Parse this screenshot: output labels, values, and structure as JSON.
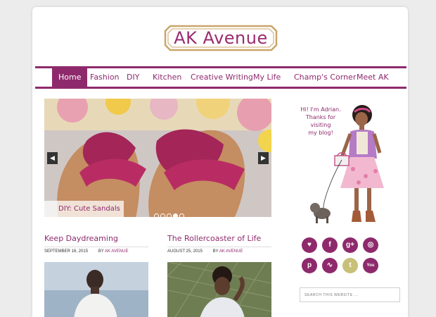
{
  "logo": {
    "text": "AK Avenue"
  },
  "nav": {
    "items": [
      {
        "label": "Home",
        "active": true
      },
      {
        "label": "Fashion"
      },
      {
        "label": "DIY"
      },
      {
        "label": "Kitchen"
      },
      {
        "label": "Creative Writing"
      },
      {
        "label": "My Life"
      },
      {
        "label": "Champ's Corner"
      },
      {
        "label": "Meet AK"
      }
    ]
  },
  "slider": {
    "caption": "DIY: Cute Sandals",
    "prev_icon": "chevron-left-icon",
    "next_icon": "chevron-right-icon",
    "dot_count": 5,
    "active_dot": 4
  },
  "posts": [
    {
      "title": "Keep Daydreaming",
      "date": "SEPTEMBER 16, 2015",
      "by": "BY",
      "author": "AK AVENUE"
    },
    {
      "title": "The Rollercoaster of Life",
      "date": "AUGUST 25, 2015",
      "by": "BY",
      "author": "AK AVENUE"
    }
  ],
  "sidebar": {
    "greeting_lines": [
      "Hi! I'm Adrian.",
      "Thanks for visiting",
      "my blog!"
    ],
    "social": [
      {
        "name": "bloglovin-icon",
        "glyph": "♥"
      },
      {
        "name": "facebook-icon",
        "glyph": "f"
      },
      {
        "name": "google-plus-icon",
        "glyph": "g+"
      },
      {
        "name": "instagram-icon",
        "glyph": "◎"
      },
      {
        "name": "pinterest-icon",
        "glyph": "p"
      },
      {
        "name": "rss-icon",
        "glyph": "∿"
      },
      {
        "name": "twitter-icon",
        "glyph": "t"
      },
      {
        "name": "youtube-icon",
        "glyph": "You"
      }
    ],
    "search_placeholder": "SEARCH THIS WEBSITE ..."
  },
  "colors": {
    "accent": "#8e2a6c",
    "gold": "#c9a56a",
    "twitter": "#c8c079"
  }
}
